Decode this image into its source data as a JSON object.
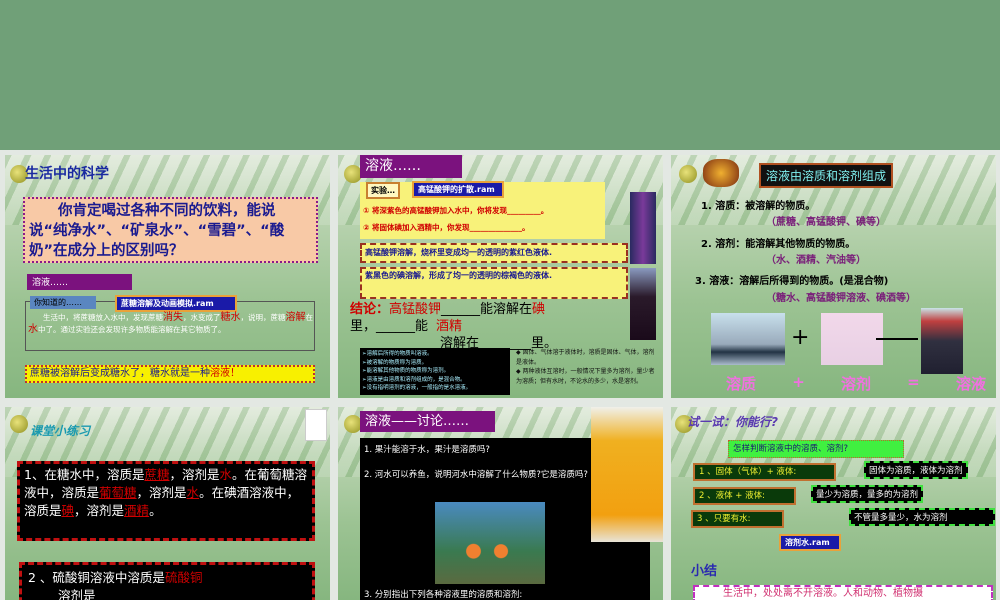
{
  "slides": [
    {
      "title": "生活中的科学",
      "question": "你肯定喝过各种不同的饮料，能说说“纯净水”、“矿泉水”、“雪碧”、“酸奶”在成分上的区别吗？",
      "section": "溶液……",
      "tag": "你知道的……",
      "link": "蔗糖溶解及动画模拟.ram",
      "para_a": "生活中，将蔗糖放入水中，发现蔗糖",
      "ans1": "消失",
      "para_b": "，水变成了",
      "ans2": "糖水",
      "para_c": "，说明，蔗糖",
      "ans3": "溶解",
      "para_d": "在",
      "ans4": "水",
      "para_e": "中了。通过实验还会发现许多物质能溶解在其它物质了。",
      "conclusion_a": "蔗糖被溶解后变成糖水了，糖水就是一种",
      "conclusion_b": "溶液",
      "conclusion_c": "！"
    },
    {
      "title": "溶液……",
      "tag": "实验…",
      "link": "高锰酸钾的扩散.ram",
      "step1": "① 将深紫色的高锰酸钾加入水中，你将发现_________。",
      "step2": "② 将固体碘加入酒精中，你发现______________。",
      "obs1": "高锰酸钾溶解，烧杯里变成均一的透明的紫红色液体.",
      "obs2": "紫黑色的碘溶解，形成了均一的透明的棕褐色的液体.",
      "conc_label": "结论：",
      "conc_a1": "高锰酸钾",
      "conc_t1": "能溶解在",
      "conc_a2": "碘",
      "conc_t2": "里，______能",
      "conc_a3": "酒精",
      "conc_t3": "溶解在________里。",
      "notes": [
        "➢溶解后所得的物质叫溶液。",
        "➢被溶解的物质称为溶质。",
        "➢能溶解其他物质的物质称为溶剂。",
        "➢溶液是由溶质和溶剂组成的，是混合物。",
        "➢没有指明溶剂的溶液，一般指的是水溶液。"
      ],
      "side1": "◆ 固体、气体溶于液体时，溶质是固体、气体，溶剂是液体。",
      "side2": "◆ 两种液体互溶时，一般情况下量多为溶剂，量少者为溶质；但有水时，不论水的多少，水是溶剂。"
    },
    {
      "title": "溶液由溶质和溶剂组成",
      "l1": "1. 溶质：被溶解的物质。",
      "l1b": "（蔗糖、高锰酸钾、碘等）",
      "l2": "2. 溶剂：能溶解其他物质的物质。",
      "l2b": "（水、酒精、汽油等）",
      "l3": "3. 溶液：溶解后所得到的物质。(是混合物)",
      "l3b": "（糖水、高锰酸钾溶液、碘酒等）",
      "plus": "+",
      "eq": [
        "溶质",
        "+",
        "溶剂",
        "=",
        "溶液"
      ]
    },
    {
      "title": "课堂小练习",
      "q1a": "1、在糖水中，溶质是",
      "q1ans1": "蔗糖",
      "q1b": "，溶剂是",
      "q1ans2": "水",
      "q1c": "。在葡萄糖溶液中，溶质是",
      "q1ans3": "葡萄糖",
      "q1d": "，溶剂是",
      "q1ans4": "水",
      "q1e": "。在碘酒溶液中，溶质是",
      "q1ans5": "碘",
      "q1f": "，溶剂是",
      "q1ans6": "酒精",
      "q1g": "。",
      "q2a": "2 、硫酸铜溶液中溶质是",
      "q2ans1": "硫酸铜",
      "q2b": "溶剂是"
    },
    {
      "title": "溶液——讨论……",
      "q1": "1. 果汁能溶于水，果汁是溶质吗?",
      "q2": "2. 河水可以养鱼，说明河水中溶解了什么物质?它是溶质吗?",
      "q3": "3. 分别指出下列各种溶液里的溶质和溶剂:"
    },
    {
      "title": "试一试：你能行?",
      "question": "怎样判断溶液中的溶质、溶剂?",
      "r1": "1 、固体（气体）+ 液体:",
      "a1": "固体为溶质，液体为溶剂",
      "r2": "2 、液体 + 液体:",
      "a2": "量少为溶质，量多的为溶剂",
      "r3": "3 、只要有水:",
      "a3": "不管量多量少，水为溶剂",
      "link": "溶剂水.ram",
      "summary_title": "小结",
      "summary": "生活中，处处离不开溶液。人和动物、植物摄"
    }
  ]
}
